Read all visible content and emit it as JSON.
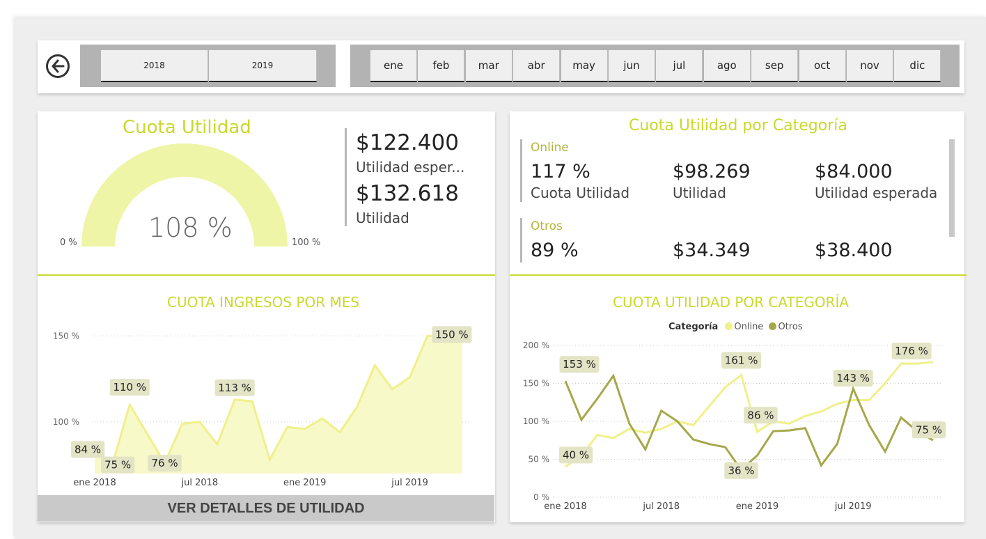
{
  "filters": {
    "years": [
      "2018",
      "2019"
    ],
    "months": [
      "ene",
      "feb",
      "mar",
      "abr",
      "may",
      "jun",
      "jul",
      "ago",
      "sep",
      "oct",
      "nov",
      "dic"
    ]
  },
  "gauge": {
    "title": "Cuota Utilidad",
    "value": "108 %",
    "value_fraction": 1.08,
    "min_label": "0 %",
    "max_label": "100 %",
    "fill_color": "#eff5a6"
  },
  "kpis": {
    "expected_value": "$122.400",
    "expected_label": "Utilidad esper...",
    "actual_value": "$132.618",
    "actual_label": "Utilidad"
  },
  "category_card": {
    "title": "Cuota Utilidad por Categoría",
    "groups": [
      {
        "name": "Online",
        "cuota": "117 %",
        "cuota_label": "Cuota Utilidad",
        "utilidad": "$98.269",
        "utilidad_label": "Utilidad",
        "esperada": "$84.000",
        "esperada_label": "Utilidad esperada"
      },
      {
        "name": "Otros",
        "cuota": "89 %",
        "utilidad": "$34.349",
        "esperada": "$38.400"
      }
    ]
  },
  "ver_button": "VER DETALLES DE UTILIDAD",
  "colors": {
    "accent": "#c9d92c",
    "online": "#f0f08a",
    "otros": "#a5a84a",
    "label_bg": "#e3e4c5"
  },
  "chart_data": [
    {
      "type": "area",
      "title": "CUOTA INGRESOS POR MES",
      "x_ticks": [
        "ene 2018",
        "jul 2018",
        "ene 2019",
        "jul 2019"
      ],
      "y_ticks": [
        "150 %",
        "100 %"
      ],
      "ylim": [
        70,
        155
      ],
      "grid": true,
      "values": [
        84,
        75,
        110,
        93,
        76,
        99,
        100,
        87,
        113,
        112,
        78,
        97,
        96,
        102,
        94,
        109,
        133,
        119,
        126,
        150,
        150,
        150
      ],
      "labels": [
        {
          "i": 0,
          "text": "84 %"
        },
        {
          "i": 1,
          "text": "75 %"
        },
        {
          "i": 2,
          "text": "110 %"
        },
        {
          "i": 4,
          "text": "76 %"
        },
        {
          "i": 8,
          "text": "113 %"
        },
        {
          "i": 20,
          "text": "150 %"
        }
      ]
    },
    {
      "type": "line",
      "title": "CUOTA UTILIDAD POR CATEGORÍA",
      "legend_title": "Categoría",
      "legend_position": "top",
      "x_ticks": [
        "ene 2018",
        "jul 2018",
        "ene 2019",
        "jul 2019"
      ],
      "y_ticks": [
        "200 %",
        "150 %",
        "100 %",
        "50 %",
        "0 %"
      ],
      "ylim": [
        0,
        200
      ],
      "grid": true,
      "series": [
        {
          "name": "Online",
          "values": [
            40,
            55,
            82,
            78,
            90,
            85,
            90,
            100,
            95,
            120,
            145,
            161,
            86,
            100,
            97,
            107,
            113,
            123,
            128,
            128,
            150,
            176,
            176,
            178
          ]
        },
        {
          "name": "Otros",
          "values": [
            153,
            102,
            130,
            160,
            97,
            63,
            114,
            100,
            76,
            70,
            66,
            36,
            55,
            87,
            88,
            91,
            42,
            70,
            143,
            95,
            60,
            105,
            87,
            75
          ]
        }
      ],
      "labels": [
        {
          "series": 1,
          "i": 0,
          "text": "153 %"
        },
        {
          "series": 0,
          "i": 0,
          "text": "40 %"
        },
        {
          "series": 0,
          "i": 11,
          "text": "161 %"
        },
        {
          "series": 1,
          "i": 11,
          "text": "36 %"
        },
        {
          "series": 0,
          "i": 12,
          "text": "86 %"
        },
        {
          "series": 1,
          "i": 18,
          "text": "143 %"
        },
        {
          "series": 0,
          "i": 21,
          "text": "176 %"
        },
        {
          "series": 1,
          "i": 23,
          "text": "75 %"
        }
      ]
    }
  ]
}
